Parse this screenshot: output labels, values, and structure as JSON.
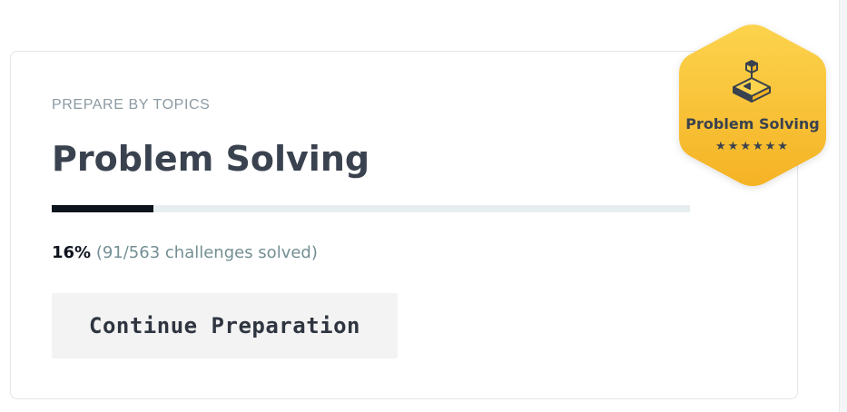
{
  "card": {
    "eyebrow": "PREPARE BY TOPICS",
    "title": "Problem Solving",
    "progress": {
      "fraction": 0.16,
      "percent_label": "16%",
      "detail": " (91/563 challenges solved)"
    },
    "continue_label": "Continue Preparation"
  },
  "badge": {
    "label": "Problem Solving",
    "stars": "★★★★★★",
    "star_count": 6,
    "icon": "cube-on-platform-icon",
    "color_top": "#fcd34d",
    "color_bottom": "#f5b325"
  },
  "colors": {
    "title": "#39424e",
    "muted": "#8c9aa3",
    "progress_fill": "#0e141e",
    "progress_track": "#e7eef0",
    "button_bg": "#f3f3f3"
  }
}
